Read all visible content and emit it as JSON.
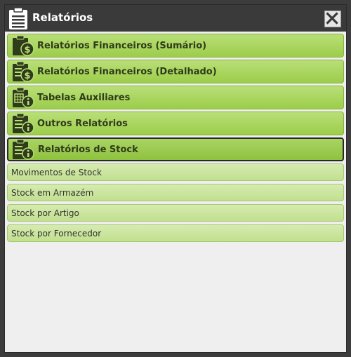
{
  "window": {
    "title": "Relatórios",
    "title_icon": "clipboard-list-icon",
    "close_icon": "close-x-icon"
  },
  "categories": [
    {
      "label": "Relatórios Financeiros (Sumário)",
      "icon": "clipboard-dollar-icon"
    },
    {
      "label": "Relatórios Financeiros (Detalhado)",
      "icon": "clipboard-dollar-list-icon"
    },
    {
      "label": "Tabelas Auxiliares",
      "icon": "clipboard-table-info-icon"
    },
    {
      "label": "Outros Relatórios",
      "icon": "clipboard-info-icon"
    },
    {
      "label": "Relatórios de Stock",
      "icon": "clipboard-info-icon"
    }
  ],
  "active_category": "Relatórios de Stock",
  "sub_items": [
    {
      "label": "Movimentos de Stock"
    },
    {
      "label": "Stock em Armazém"
    },
    {
      "label": "Stock por Artigo"
    },
    {
      "label": "Stock por Fornecedor"
    }
  ],
  "colors": {
    "titlebar": "#3a3a3a",
    "category_green": "#9ccd4a",
    "subitem_green": "#c2e08f",
    "panel_bg": "#efefef"
  }
}
